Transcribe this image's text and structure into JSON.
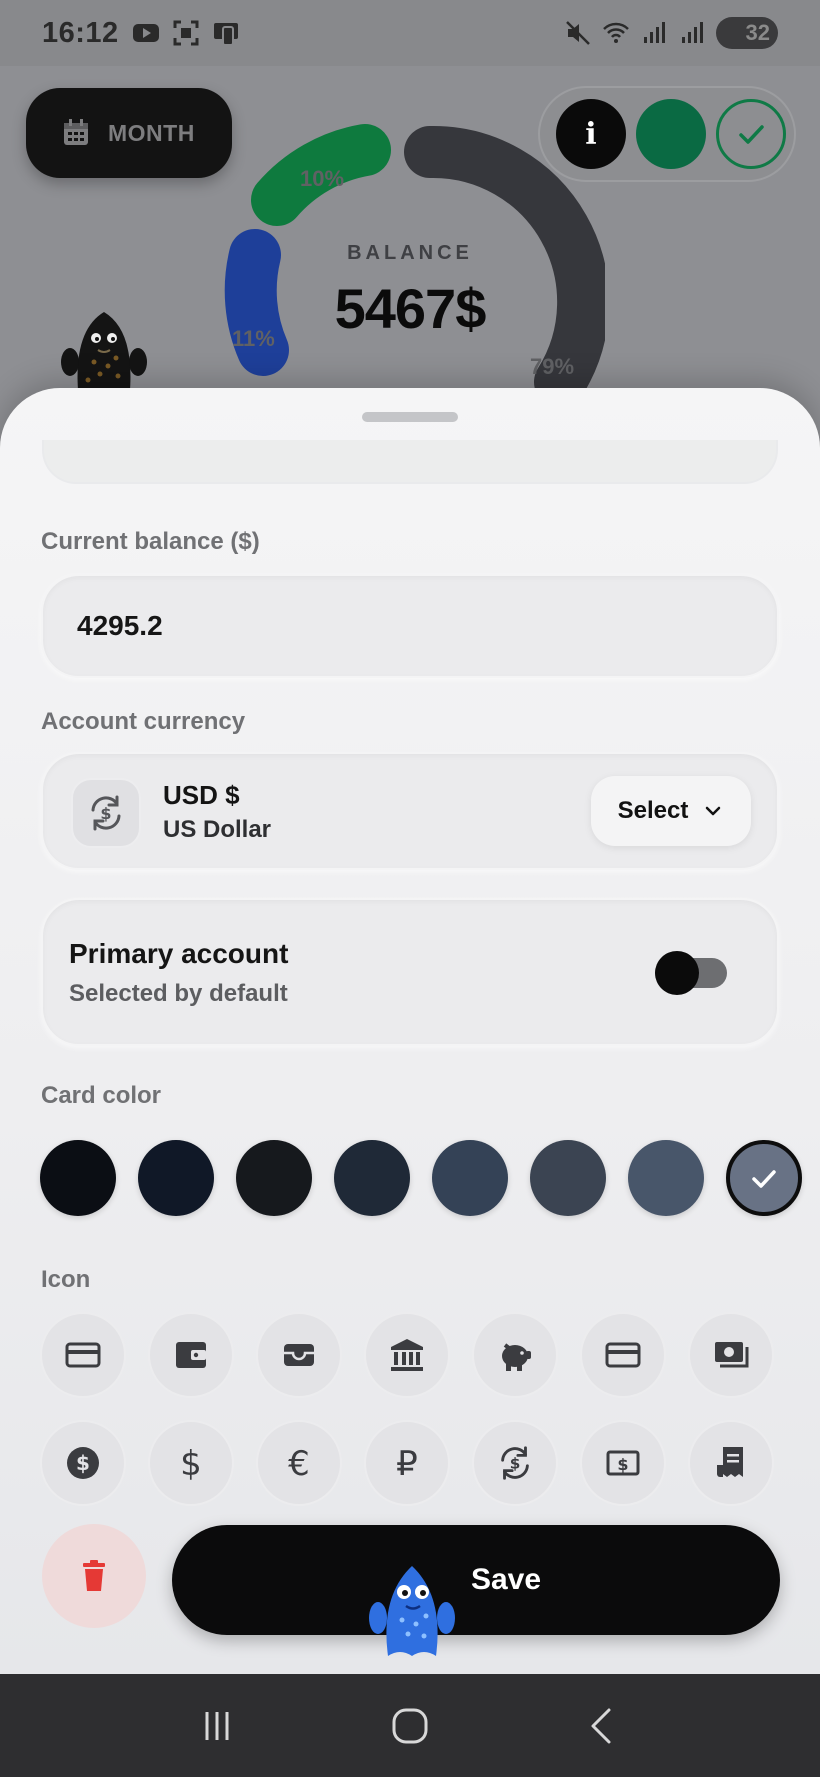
{
  "status_bar": {
    "time": "16:12",
    "battery": "32"
  },
  "header": {
    "period_button_label": "MONTH",
    "info_button_label": "i"
  },
  "balance_chart": {
    "label": "BALANCE",
    "value": "5467$",
    "segments": [
      {
        "label": "10%",
        "color": "#0e7a3e"
      },
      {
        "label": "11%",
        "color": "#1e3f99"
      },
      {
        "label": "79%",
        "color": "#36373c"
      }
    ]
  },
  "form": {
    "current_balance_label": "Current balance ($)",
    "current_balance_value": "4295.2",
    "account_currency_label": "Account currency",
    "currency_code": "USD  $",
    "currency_name": "US Dollar",
    "select_label": "Select",
    "primary_account_title": "Primary account",
    "primary_account_subtitle": "Selected by default",
    "primary_account_enabled": true,
    "card_color_label": "Card color",
    "card_colors": [
      "#0b0e14",
      "#101827",
      "#16191d",
      "#1f2937",
      "#344256",
      "#3b4452",
      "#48566a",
      "#687285"
    ],
    "selected_card_color_index": 7,
    "icon_label": "Icon",
    "icons_row1": [
      "credit-card-icon",
      "wallet-icon",
      "card-holder-icon",
      "bank-icon",
      "piggy-bank-icon",
      "card-alt-icon",
      "cash-stack-icon"
    ],
    "icons_row2": [
      "dollar-circle-icon",
      "dollar-icon",
      "euro-icon",
      "ruble-icon",
      "currency-exchange-icon",
      "money-bill-icon",
      "receipt-icon"
    ],
    "save_label": "Save"
  }
}
